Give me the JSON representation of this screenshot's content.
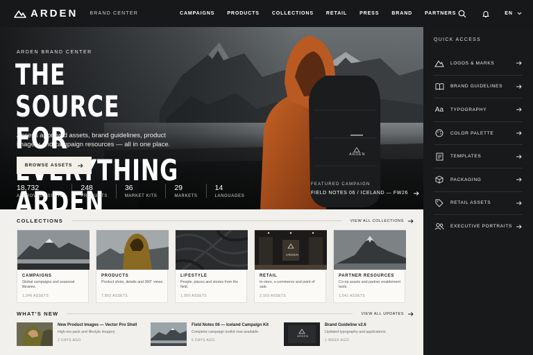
{
  "header": {
    "brand": "ARDEN",
    "brand_center": "BRAND CENTER",
    "nav": [
      "CAMPAIGNS",
      "PRODUCTS",
      "COLLECTIONS",
      "RETAIL",
      "PRESS",
      "BRAND",
      "PARTNERS"
    ],
    "language": "EN",
    "icons": [
      "search-icon",
      "bell-icon",
      "chevron-down-icon"
    ]
  },
  "hero": {
    "eyebrow": "ARDEN BRAND CENTER",
    "title": "THE SOURCE FOR EVERYTHING ARDEN",
    "description": "Access approved assets, brand guidelines, product imagery and campaign resources — all in one place.",
    "button_label": "BROWSE ASSETS",
    "backpack_logo": "ARDEN",
    "stats": [
      {
        "value": "18,732",
        "label": "APPROVED ASSETS"
      },
      {
        "value": "248",
        "label": "PRODUCTS"
      },
      {
        "value": "36",
        "label": "MARKET KITS"
      },
      {
        "value": "29",
        "label": "MARKETS"
      },
      {
        "value": "14",
        "label": "LANGUAGES"
      }
    ],
    "featured": {
      "eyebrow": "FEATURED CAMPAIGN",
      "title": "FIELD NOTES 06 / ICELAND — FW26"
    }
  },
  "quick_access": {
    "title": "QUICK ACCESS",
    "items": [
      {
        "label": "LOGOS & MARKS",
        "icon": "mountain-logo-icon"
      },
      {
        "label": "BRAND GUIDELINES",
        "icon": "book-icon"
      },
      {
        "label": "TYPOGRAPHY",
        "icon": "Aa"
      },
      {
        "label": "COLOR PALETTE",
        "icon": "palette-icon"
      },
      {
        "label": "TEMPLATES",
        "icon": "template-icon"
      },
      {
        "label": "PACKAGING",
        "icon": "box-icon"
      },
      {
        "label": "RETAIL ASSETS",
        "icon": "tag-icon"
      },
      {
        "label": "EXECUTIVE PORTRAITS",
        "icon": "people-icon"
      }
    ]
  },
  "collections": {
    "title": "COLLECTIONS",
    "view_all": "VIEW ALL COLLECTIONS",
    "cards": [
      {
        "title": "CAMPAIGNS",
        "desc": "Global campaigns and seasonal libraries.",
        "count": "1,246 ASSETS"
      },
      {
        "title": "PRODUCTS",
        "desc": "Product shots, details and 360° views.",
        "count": "7,892 ASSETS"
      },
      {
        "title": "LIFESTYLE",
        "desc": "People, places and stories from the field.",
        "count": "1,950 ASSETS"
      },
      {
        "title": "RETAIL",
        "desc": "In-store, e-commerce and point of sale.",
        "count": "2,103 ASSETS"
      },
      {
        "title": "PARTNER RESOURCES",
        "desc": "Co-op assets and partner enablement tools.",
        "count": "1,541 ASSETS"
      }
    ]
  },
  "whats_new": {
    "title": "WHAT'S NEW",
    "view_all": "VIEW ALL UPDATES",
    "items": [
      {
        "title": "New Product Images — Vector Pro Shell",
        "desc": "High-res pack and lifestyle imagery.",
        "time": "2 DAYS AGO"
      },
      {
        "title": "Field Notes 06 — Iceland Campaign Kit",
        "desc": "Complete campaign toolkit now available.",
        "time": "5 DAYS AGO"
      },
      {
        "title": "Brand Guideline v2.6",
        "desc": "Updated typography and applications.",
        "time": "1 WEEK AGO"
      }
    ]
  },
  "colors": {
    "dark_bg": "#16181a",
    "panel_bg": "#17191b",
    "page_bg": "#f1f0ec",
    "jacket": "#b1531f",
    "button_bg": "#f4f1ea"
  }
}
